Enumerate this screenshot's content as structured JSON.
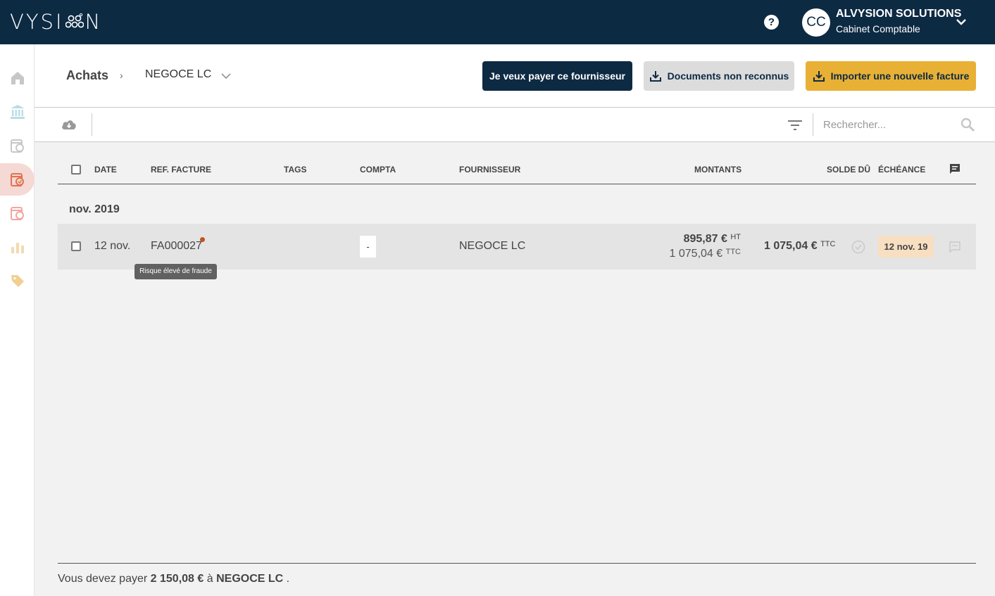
{
  "app": {
    "logo_left": "VYSI",
    "logo_right": "N"
  },
  "topbar": {
    "help_label": "?",
    "avatar_initials": "CC",
    "company_name": "ALVYSION SOLUTIONS",
    "company_role": "Cabinet Comptable"
  },
  "sidebar": {
    "items": [
      {
        "icon": "home-icon",
        "color": "#c7c7c7"
      },
      {
        "icon": "bank-icon",
        "color": "#b8dde6"
      },
      {
        "icon": "sales-invoice-icon",
        "color": "#c7c7c7"
      },
      {
        "icon": "purchase-invoice-icon",
        "color": "#e0734f",
        "active": true
      },
      {
        "icon": "expense-icon",
        "color": "#f2a6a0"
      },
      {
        "icon": "analytics-icon",
        "color": "#f2dbb0"
      },
      {
        "icon": "tag-icon",
        "color": "#f2cf90"
      }
    ]
  },
  "breadcrumb": {
    "root": "Achats",
    "separator": "›",
    "current": "NEGOCE LC"
  },
  "actions": {
    "pay_supplier": "Je veux payer ce fournisseur",
    "unrecognized_docs": "Documents non reconnus",
    "import_invoice": "Importer une nouvelle facture"
  },
  "toolbar": {
    "search_placeholder": "Rechercher..."
  },
  "table": {
    "headers": {
      "date": "DATE",
      "ref": "REF. FACTURE",
      "tags": "TAGS",
      "compta": "COMPTA",
      "supplier": "FOURNISSEUR",
      "amounts": "MONTANTS",
      "balance": "SOLDE DÛ",
      "due": "ÉCHÉANCE"
    },
    "groups": [
      {
        "label": "nov. 2019",
        "rows": [
          {
            "date": "12 nov.",
            "ref": "FA000027",
            "compta": "-",
            "supplier": "NEGOCE LC",
            "amount_ht": "895,87 €",
            "ht_label": "HT",
            "amount_ttc": "1 075,04 €",
            "ttc_label": "TTC",
            "balance": "1 075,04 €",
            "balance_label": "TTC",
            "due_date": "12 nov. 19",
            "tooltip": "Risque élevé de fraude"
          }
        ]
      }
    ]
  },
  "footer": {
    "prefix": "Vous devez payer",
    "amount": "2 150,08 €",
    "middle": "à",
    "supplier": "NEGOCE LC",
    "suffix": "."
  },
  "colors": {
    "brand_dark": "#0d2a43",
    "accent_yellow": "#e8b035",
    "fraud_dot": "#c1531b",
    "due_badge": "#f8dfc1"
  }
}
